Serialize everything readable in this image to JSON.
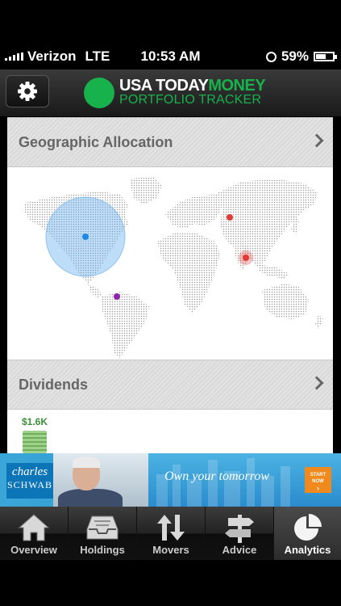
{
  "status_bar": {
    "carrier": "Verizon",
    "network": "LTE",
    "time": "10:53 AM",
    "battery": "59%",
    "battery_level": 0.59
  },
  "nav": {
    "logo_usa_today": "USA TODAY",
    "logo_money": "MONEY",
    "logo_subtitle": "PORTFOLIO TRACKER",
    "settings_icon": "gear-icon"
  },
  "sections": {
    "geographic_title": "Geographic Allocation",
    "dividends_title": "Dividends",
    "dividends_amount": "$1.6K"
  },
  "map_markers": [
    {
      "region": "North America",
      "color": "#1e88e5",
      "has_halo": true
    },
    {
      "region": "South America",
      "color": "#8e24aa",
      "has_halo": false
    },
    {
      "region": "Russia",
      "color": "#e53935",
      "has_halo": false
    },
    {
      "region": "China",
      "color": "#e53935",
      "has_halo": true
    }
  ],
  "ad": {
    "brand_line1": "charles",
    "brand_line2": "SCHWAB",
    "tagline": "Own your tomorrow",
    "cta_line1": "START",
    "cta_line2": "NOW"
  },
  "tabs": [
    {
      "label": "Overview",
      "icon": "house-icon",
      "active": false
    },
    {
      "label": "Holdings",
      "icon": "inbox-icon",
      "active": false
    },
    {
      "label": "Movers",
      "icon": "up-down-arrows-icon",
      "active": false
    },
    {
      "label": "Advice",
      "icon": "signpost-icon",
      "active": false
    },
    {
      "label": "Analytics",
      "icon": "pie-chart-icon",
      "active": true
    }
  ],
  "colors": {
    "brand_green": "#17b24b",
    "marker_blue": "#1e88e5",
    "marker_red": "#e53935",
    "marker_purple": "#8e24aa"
  }
}
